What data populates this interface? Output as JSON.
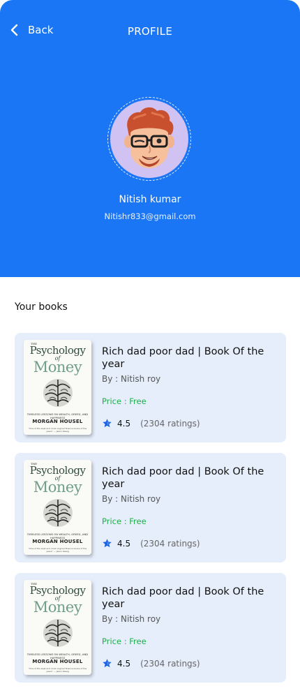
{
  "header": {
    "back_label": "Back",
    "title": "PROFILE"
  },
  "profile": {
    "name": "Nitish kumar",
    "email": "Nitishr833@gmail.com",
    "avatar_bg": "#d0c2f2"
  },
  "section_title": "Your books",
  "cover": {
    "the": "THE",
    "line1": "Psychology",
    "of": "of",
    "line2": "Money",
    "tagline": "TIMELESS LESSONS ON WEALTH, GREED, AND HAPPINESS",
    "author": "MORGAN HOUSEL",
    "blurb": "\"One of the best and most original finance books of the years\" — Jason Zweig"
  },
  "books": [
    {
      "title": "Rich dad poor dad | Book Of the year",
      "author": "By : Nitish roy",
      "price": "Price : Free",
      "rating": "4.5",
      "ratings_count": "(2304 ratings)"
    },
    {
      "title": "Rich dad poor dad | Book Of the year",
      "author": "By : Nitish roy",
      "price": "Price : Free",
      "rating": "4.5",
      "ratings_count": "(2304 ratings)"
    },
    {
      "title": "Rich dad poor dad | Book Of the year",
      "author": "By : Nitish roy",
      "price": "Price : Free",
      "rating": "4.5",
      "ratings_count": "(2304 ratings)"
    }
  ],
  "colors": {
    "header_bg": "#1a76f5",
    "card_bg": "#e6eefb",
    "price_green": "#1bb04a",
    "star_blue": "#1a5fe0"
  },
  "icons": {
    "back": "chevron-left-icon",
    "rating": "star-icon",
    "avatar": "memoji-avatar"
  }
}
